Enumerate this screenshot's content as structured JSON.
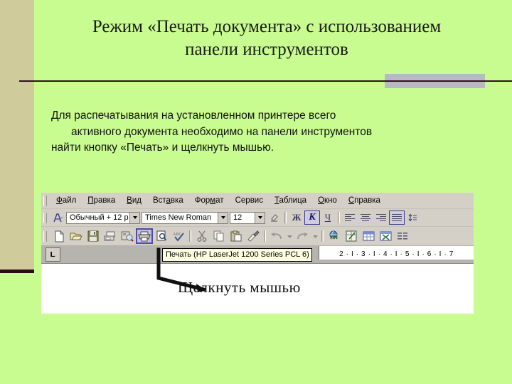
{
  "slide": {
    "title": "Режим «Печать документа» с использованием панели инструментов",
    "body": {
      "line1": "Для распечатывания на установленном принтере всего",
      "line2": "активного документа необходимо на панели инструментов",
      "line3": "найти кнопку «Печать» и щелкнуть мышью."
    },
    "callout_label": "Щелкнуть мышью",
    "colors": {
      "background": "#c9fc90",
      "left_band": "#cfcb9b",
      "rule": "#30101d",
      "rule_block": "#b6b6c6",
      "highlight": "#514aa8"
    }
  },
  "word": {
    "menubar": [
      {
        "label": "Файл",
        "accel": "Ф"
      },
      {
        "label": "Правка",
        "accel": "П"
      },
      {
        "label": "Вид",
        "accel": "В"
      },
      {
        "label": "Вставка",
        "accel": "а"
      },
      {
        "label": "Формат",
        "accel": "м"
      },
      {
        "label": "Сервис",
        "accel": "С"
      },
      {
        "label": "Таблица",
        "accel": "Т"
      },
      {
        "label": "Окно",
        "accel": "О"
      },
      {
        "label": "Справка",
        "accel": "С"
      }
    ],
    "formatbar": {
      "style_value": "Обычный + 12 p",
      "font_value": "Times New Roman",
      "size_value": "12",
      "bold_label": "Ж",
      "italic_label": "К",
      "underline_label": "Ч",
      "italic_active": true,
      "justify_active": true,
      "buttons": [
        "style-gallery-button",
        "style-box",
        "font-box",
        "size-box",
        "highlight-color-button",
        "bold-button",
        "italic-button",
        "underline-button",
        "align-left-button",
        "align-center-button",
        "align-right-button",
        "justify-button",
        "line-spacing-button"
      ]
    },
    "standardbar": {
      "buttons": [
        "new-document-button",
        "open-button",
        "save-button",
        "email-button",
        "search-button",
        "print-button",
        "print-preview-button",
        "spelling-button",
        "cut-button",
        "copy-button",
        "paste-button",
        "format-painter-button",
        "undo-button",
        "undo-dropdown",
        "redo-button",
        "redo-dropdown",
        "hyperlink-button",
        "tables-and-borders-button",
        "insert-table-button",
        "insert-excel-table-button",
        "columns-button"
      ],
      "hovered_button": "print-button"
    },
    "tooltip": "Печать (HP LaserJet 1200 Series PCL 6)",
    "ruler": {
      "tab_stop_label": "L",
      "marks": "2 · I · 3 · I · 4 · I · 5 · I · 6 · I · 7"
    }
  }
}
